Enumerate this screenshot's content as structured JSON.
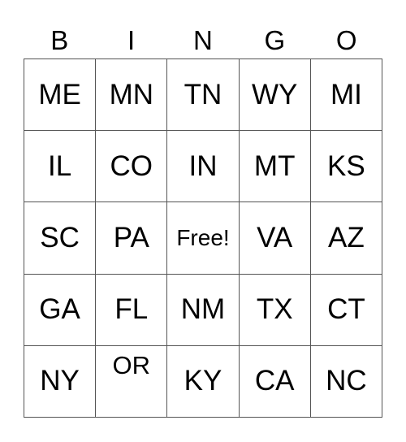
{
  "header": [
    "B",
    "I",
    "N",
    "G",
    "O"
  ],
  "cells": [
    [
      "ME",
      "MN",
      "TN",
      "WY",
      "MI"
    ],
    [
      "IL",
      "CO",
      "IN",
      "MT",
      "KS"
    ],
    [
      "SC",
      "PA",
      "Free!",
      "VA",
      "AZ"
    ],
    [
      "GA",
      "FL",
      "NM",
      "TX",
      "CT"
    ],
    [
      "NY",
      "OR",
      "KY",
      "CA",
      "NC"
    ]
  ]
}
